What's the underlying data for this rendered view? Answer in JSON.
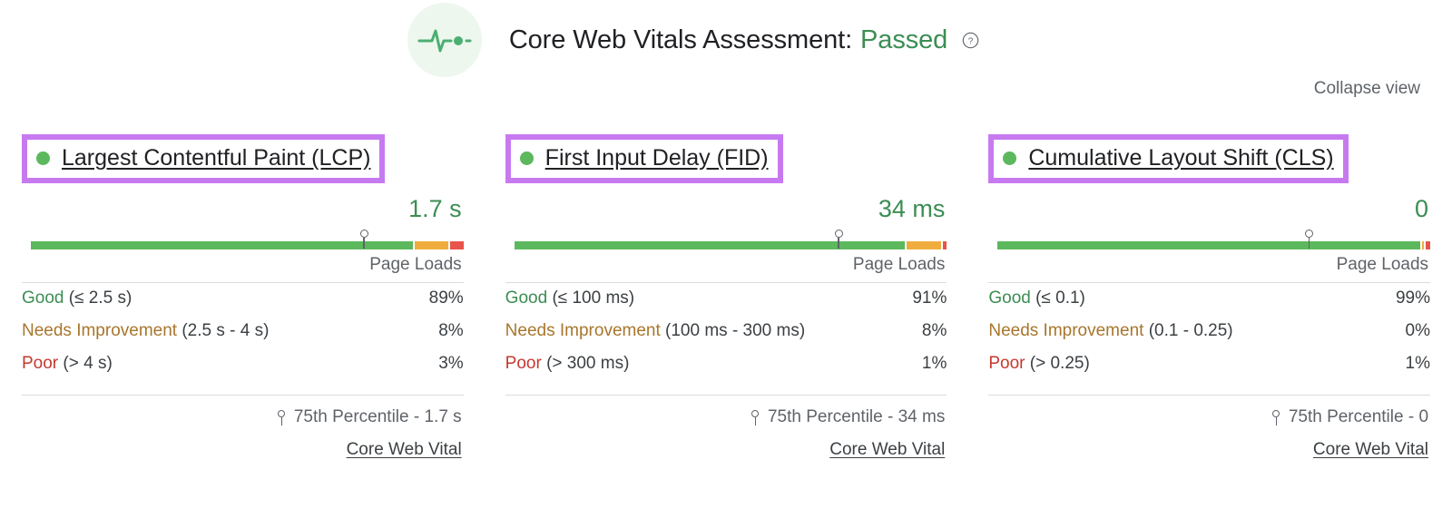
{
  "header": {
    "icon": "pulse-icon",
    "title_prefix": "Core Web Vitals Assessment:",
    "status": "Passed",
    "help_icon": "help-circle-icon",
    "status_color": "#3c8d53"
  },
  "collapse_view_label": "Collapse view",
  "colors": {
    "good": "#5cb85c",
    "needs_improvement": "#f0ad3e",
    "poor": "#e8544a",
    "highlight_border": "#c77af0",
    "good_text": "#3c8d53",
    "ni_text": "#a8762c",
    "poor_text": "#c5392f"
  },
  "common": {
    "page_loads_label": "Page Loads",
    "core_web_vital_label": "Core Web Vital",
    "good_label": "Good",
    "needs_improvement_label": "Needs Improvement",
    "poor_label": "Poor"
  },
  "metrics": [
    {
      "name": "Largest Contentful Paint (LCP)",
      "status_dot": "good",
      "value": "1.7 s",
      "percentile_text": "75th Percentile - 1.7 s",
      "marker_pct": 77,
      "rows": [
        {
          "level": "Good",
          "range": "(≤ 2.5 s)",
          "pct": "89%"
        },
        {
          "level": "Needs Improvement",
          "range": "(2.5 s - 4 s)",
          "pct": "8%"
        },
        {
          "level": "Poor",
          "range": "(> 4 s)",
          "pct": "3%"
        }
      ],
      "bar": {
        "good": 89,
        "needs_improvement": 8,
        "poor": 3
      }
    },
    {
      "name": "First Input Delay (FID)",
      "status_dot": "good",
      "value": "34 ms",
      "percentile_text": "75th Percentile - 34 ms",
      "marker_pct": 75,
      "rows": [
        {
          "level": "Good",
          "range": "(≤ 100 ms)",
          "pct": "91%"
        },
        {
          "level": "Needs Improvement",
          "range": "(100 ms - 300 ms)",
          "pct": "8%"
        },
        {
          "level": "Poor",
          "range": "(> 300 ms)",
          "pct": "1%"
        }
      ],
      "bar": {
        "good": 91,
        "needs_improvement": 8,
        "poor": 1
      }
    },
    {
      "name": "Cumulative Layout Shift (CLS)",
      "status_dot": "good",
      "value": "0",
      "percentile_text": "75th Percentile - 0",
      "marker_pct": 72,
      "rows": [
        {
          "level": "Good",
          "range": "(≤ 0.1)",
          "pct": "99%"
        },
        {
          "level": "Needs Improvement",
          "range": "(0.1 - 0.25)",
          "pct": "0%"
        },
        {
          "level": "Poor",
          "range": "(> 0.25)",
          "pct": "1%"
        }
      ],
      "bar": {
        "good": 99,
        "needs_improvement": 0.4,
        "poor": 1
      }
    }
  ]
}
